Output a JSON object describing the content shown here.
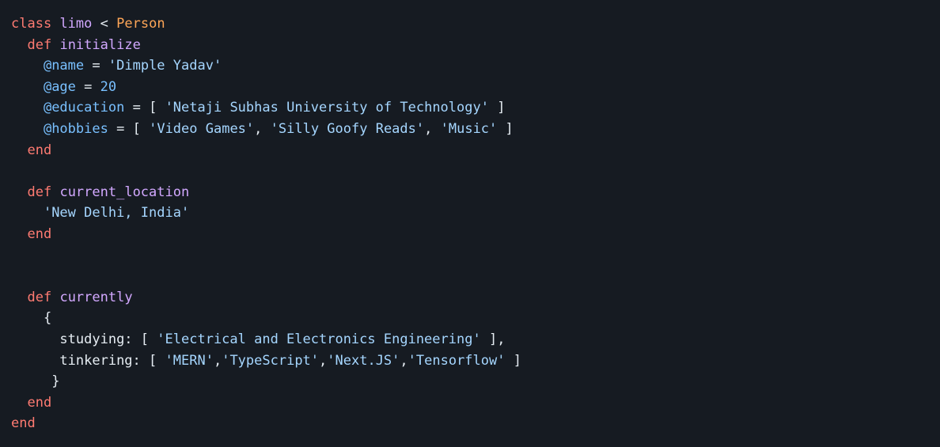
{
  "colors": {
    "background": "#161b22",
    "keyword": "#ff7b72",
    "class_name": "#ffa657",
    "function_name": "#d2a8ff",
    "instance_var": "#79c0ff",
    "string": "#a5d6ff",
    "plain": "#e6edf3"
  },
  "code": {
    "l1": {
      "kw": "class",
      "name": "limo",
      "op": "<",
      "parent": "Person"
    },
    "l2": {
      "kw": "def",
      "fn": "initialize"
    },
    "l3": {
      "ivar": "@name",
      "op": "=",
      "str": "'Dimple Yadav'"
    },
    "l4": {
      "ivar": "@age",
      "op": "=",
      "num": "20"
    },
    "l5": {
      "ivar": "@education",
      "op": "=",
      "open": "[",
      "str": "'Netaji Subhas University of Technology'",
      "close": "]"
    },
    "l6": {
      "ivar": "@hobbies",
      "op": "=",
      "open": "[",
      "s1": "'Video Games'",
      "c1": ",",
      "s2": "'Silly Goofy Reads'",
      "c2": ",",
      "s3": "'Music'",
      "close": "]"
    },
    "l7": {
      "kw": "end"
    },
    "l9": {
      "kw": "def",
      "fn": "current_location"
    },
    "l10": {
      "str": "'New Delhi, India'"
    },
    "l11": {
      "kw": "end"
    },
    "l14": {
      "kw": "def",
      "fn": "currently"
    },
    "l15": {
      "brace": "{"
    },
    "l16": {
      "key": "studying:",
      "open": "[",
      "str": "'Electrical and Electronics Engineering'",
      "close": "],"
    },
    "l17": {
      "key": "tinkering:",
      "open": "[",
      "s1": "'MERN'",
      "c1": ",",
      "s2": "'TypeScript'",
      "c2": ",",
      "s3": "'Next.JS'",
      "c3": ",",
      "s4": "'Tensorflow'",
      "close": "]"
    },
    "l18": {
      "brace": "}"
    },
    "l19": {
      "kw": "end"
    },
    "l20": {
      "kw": "end"
    }
  }
}
